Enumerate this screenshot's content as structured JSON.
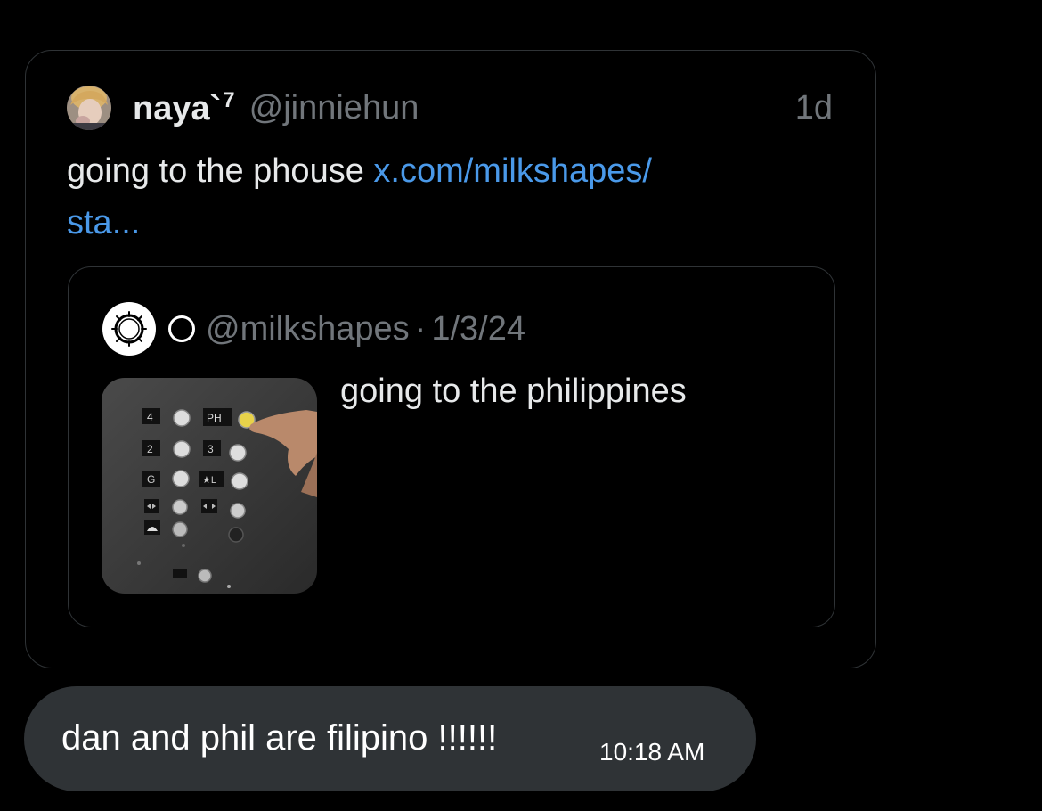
{
  "shared_post": {
    "display_name": "naya`",
    "display_name_sup": "7",
    "handle": "@jinniehun",
    "time": "1d",
    "text": "going to the phouse ",
    "link_text": "x.com/milkshapes/",
    "link_text_cont": "sta..."
  },
  "quoted_post": {
    "handle": "@milkshapes",
    "separator": "·",
    "date": "1/3/24",
    "text": "going to the philippines",
    "media_icon": "elevator-buttons-photo",
    "media_labels": {
      "floor_4": "4",
      "floor_ph": "PH",
      "floor_2": "2",
      "floor_3": "3",
      "floor_g": "G",
      "floor_l": "★L"
    }
  },
  "message": {
    "text": "dan and phil are filipino !!!!!!",
    "time": "10:18 AM"
  },
  "colors": {
    "background": "#000000",
    "card_border": "#2f3336",
    "link": "#4a99e9",
    "muted": "#71767b",
    "bubble": "#2f3336"
  }
}
